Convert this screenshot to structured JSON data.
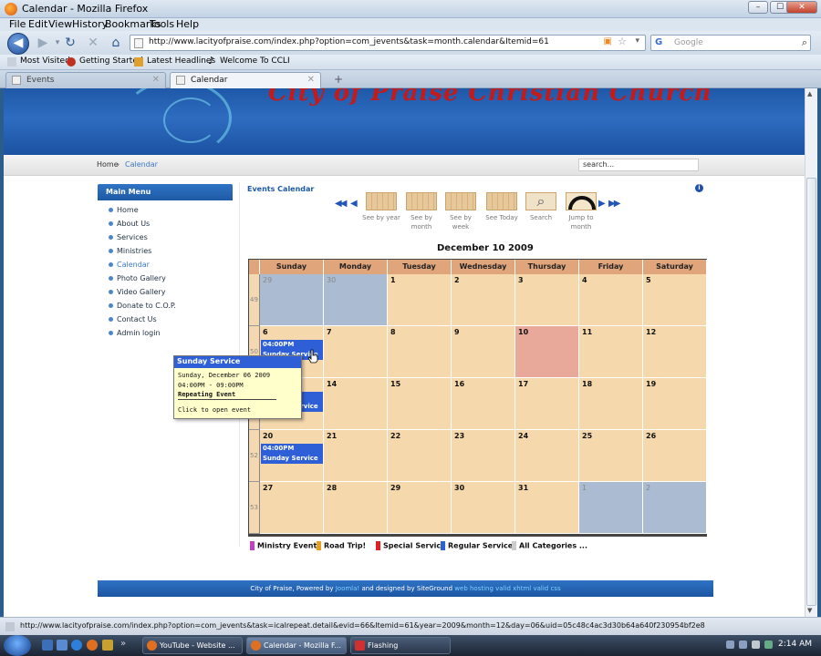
{
  "window": {
    "title": "Calendar - Mozilla Firefox",
    "min": "–",
    "max": "☐",
    "close": "✕"
  },
  "menu": [
    "File",
    "Edit",
    "View",
    "History",
    "Bookmarks",
    "Tools",
    "Help"
  ],
  "nav": {
    "url": "http://www.lacityofpraise.com/index.php?option=com_jevents&task=month.calendar&Itemid=61",
    "search_placeholder": "Google"
  },
  "bookmarks": [
    "Most Visited",
    "Getting Started",
    "Latest Headlines",
    "Welcome To CCLI"
  ],
  "tabs": [
    {
      "label": "Events",
      "active": false
    },
    {
      "label": "Calendar",
      "active": true
    }
  ],
  "site": {
    "banner_title": "City of Praise Christian Church",
    "breadcrumb_home": "Home",
    "breadcrumb_current": "Calendar",
    "search_value": "search...",
    "main_menu_title": "Main Menu",
    "menu_items": [
      {
        "label": "Home",
        "active": false
      },
      {
        "label": "About Us",
        "active": false
      },
      {
        "label": "Services",
        "active": false
      },
      {
        "label": "Ministries",
        "active": false
      },
      {
        "label": "Calendar",
        "active": true
      },
      {
        "label": "Photo Gallery",
        "active": false
      },
      {
        "label": "Video Gallery",
        "active": false
      },
      {
        "label": "Donate to C.O.P.",
        "active": false
      },
      {
        "label": "Contact Us",
        "active": false
      },
      {
        "label": "Admin login",
        "active": false
      }
    ]
  },
  "calendar": {
    "title": "Events Calendar",
    "nav_buttons": [
      {
        "id": "year",
        "label": "See by year"
      },
      {
        "id": "month",
        "label": "See by month"
      },
      {
        "id": "week",
        "label": "See by week"
      },
      {
        "id": "today",
        "label": "See Today"
      },
      {
        "id": "search",
        "label": "Search"
      },
      {
        "id": "jump",
        "label": "Jump to month"
      }
    ],
    "current_date": "December 10 2009",
    "weekdays": [
      "Sunday",
      "Monday",
      "Tuesday",
      "Wednesday",
      "Thursday",
      "Friday",
      "Saturday"
    ],
    "weeks": [
      {
        "week": "49",
        "days": [
          "29",
          "30",
          "1",
          "2",
          "3",
          "4",
          "5"
        ]
      },
      {
        "week": "50",
        "days": [
          "6",
          "7",
          "8",
          "9",
          "10",
          "11",
          "12"
        ]
      },
      {
        "week": "51",
        "days": [
          "13",
          "14",
          "15",
          "16",
          "17",
          "18",
          "19"
        ]
      },
      {
        "week": "52",
        "days": [
          "20",
          "21",
          "22",
          "23",
          "24",
          "25",
          "26"
        ]
      },
      {
        "week": "53",
        "days": [
          "27",
          "28",
          "29",
          "30",
          "31",
          "1",
          "2"
        ]
      }
    ],
    "event_label": "04:00PM Sunday Service",
    "legend": [
      {
        "label": "Ministry Event",
        "color": "#c040c0"
      },
      {
        "label": "Road Trip!",
        "color": "#e8a020"
      },
      {
        "label": "Special Service",
        "color": "#e02020"
      },
      {
        "label": "Regular Service",
        "color": "#2f5fd6"
      },
      {
        "label": "All Categories ...",
        "color": "#cccccc"
      }
    ],
    "colors": {
      "day": "#f5d8ab",
      "other_month": "#aabbd2",
      "today": "#e8a89a",
      "header": "#e1a57c"
    }
  },
  "tooltip": {
    "title": "Sunday Service",
    "date": "Sunday, December 06 2009",
    "time": "04:00PM - 09:00PM",
    "repeat": "Repeating Event",
    "hint": "Click to open event"
  },
  "footer": {
    "text": "City of Praise, Powered by",
    "joomla": "Joomla!",
    "mid": "and designed by SiteGround",
    "links": "web hosting valid xhtml valid css"
  },
  "status": {
    "text": "http://www.lacityofpraise.com/index.php?option=com_jevents&task=icalrepeat.detail&evid=66&Itemid=61&year=2009&month=12&day=06&uid=05c48c4ac3d30b64a640f230954bf2e8"
  },
  "taskbar": {
    "tasks": [
      "YouTube - Website ...",
      "Calendar - Mozilla F...",
      "Flashing"
    ],
    "clock": "2:14 AM"
  }
}
